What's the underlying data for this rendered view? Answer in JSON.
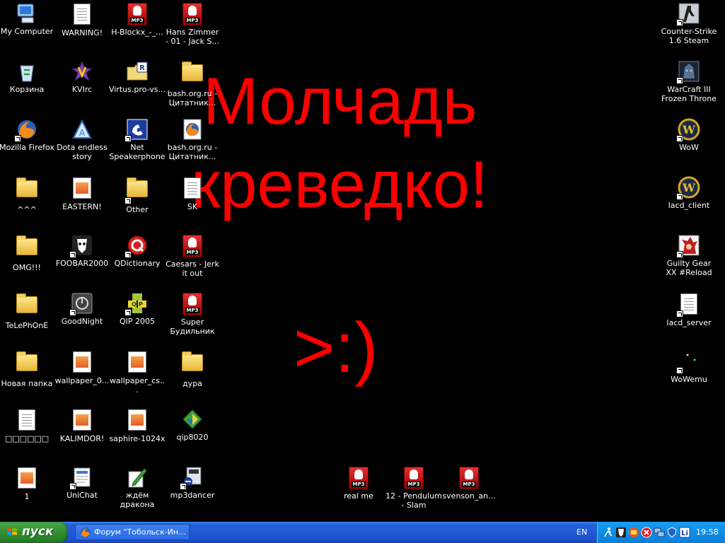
{
  "wallpaper": {
    "line1": "Молчадь",
    "line2": "креведко!",
    "smiley": ">:)"
  },
  "desktop_icons": {
    "my_computer": "My Computer",
    "warning": "WARNING!",
    "h_blockx": "H-Blockx_-_...",
    "hans_zimmer": "Hans Zimmer - 01 - Jack S...",
    "recycle_bin": "Корзина",
    "kvirc": "KVIrc",
    "virtus": "Virtus.pro-vs...",
    "bash_folder": "bash.org.ru - Цитатник...",
    "firefox": "Mozilla Firefox",
    "dota_story": "Dota endless story",
    "net_speakerphone": "Net Speakerphone",
    "bash_link": "bash.org.ru - Цитатник...",
    "folder_hats": "^^^",
    "eastern": "EASTERN!",
    "other": "Other",
    "sk": "SK",
    "omg": "OMG!!!",
    "foobar": "FOOBAR2000",
    "qdictionary": "QDictionary",
    "caesars": "Caesars - Jerk it out",
    "telephone": "TeLePhOnE",
    "goodnight": "GoodNight",
    "qip": "QIP 2005",
    "super_alarm": "Super Будильник",
    "new_folder": "Новая папка",
    "wallpaper_0": "wallpaper_0...",
    "wallpaper_cs": "wallpaper_cs...",
    "dura": "дура",
    "boxes": "□□□□□□",
    "kalimdor": "KALIMDOR!",
    "saphire": "saphire-1024x",
    "qip8020": "qip8020",
    "one": "1",
    "unichat": "UniChat",
    "dragon": "ждём дракона",
    "mp3dancer": "mp3dancer",
    "real_me": "real me",
    "pendulum": "12 - Pendulum - Slam",
    "svenson": "svenson_an...",
    "counter_strike": "Counter-Strike 1.6 Steam",
    "warcraft": "WarCraft III Frozen Throne",
    "wow": "WoW",
    "lacd_client": "lacd_client",
    "guilty_gear": "Guilty Gear XX #Reload",
    "lacd_server": "lacd_server",
    "wowemu": "WoWemu"
  },
  "taskbar": {
    "start_label": "пуск",
    "task_firefox": "Форум \"Тобольск-Ин...",
    "language": "EN",
    "clock": "19:58"
  }
}
